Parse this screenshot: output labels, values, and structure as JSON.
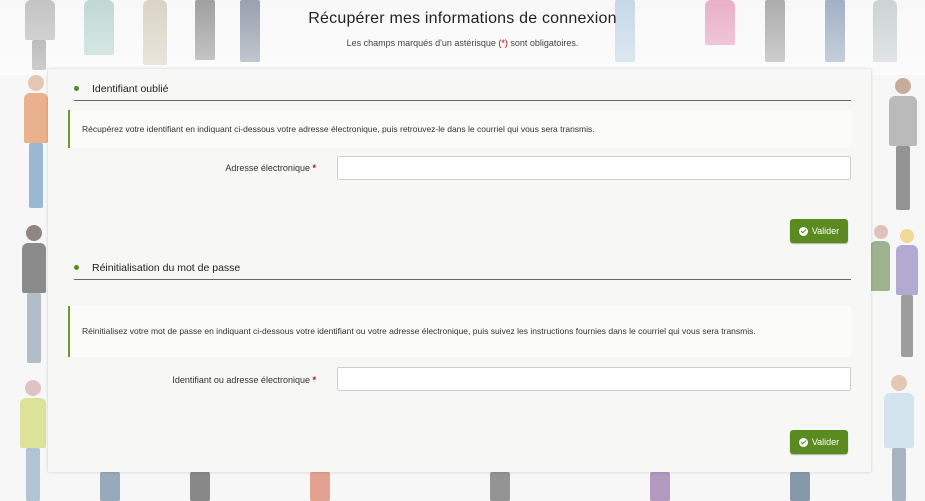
{
  "header": {
    "title": "Récupérer mes informations de connexion",
    "note_before": "Les champs marqués d'un astérisque ",
    "note_star": "(*)",
    "note_after": " sont obligatoires."
  },
  "sections": [
    {
      "title": "Identifiant oublié",
      "info": "Récupérez votre identifiant en indiquant ci-dessous votre adresse électronique, puis retrouvez-le dans le courriel qui vous sera transmis.",
      "field_label": "Adresse électronique",
      "field_value": "",
      "required_mark": "*",
      "button_label": "Valider"
    },
    {
      "title": "Réinitialisation du mot de passe",
      "info": "Réinitialisez votre mot de passe en indiquant ci-dessous votre identifiant ou votre adresse électronique, puis suivez les instructions fournies dans le courriel qui vous sera transmis.",
      "field_label": "Identifiant ou adresse électronique",
      "field_value": "",
      "required_mark": "*",
      "button_label": "Valider"
    }
  ],
  "colors": {
    "accent": "#5b8a21",
    "required": "#cc0000"
  },
  "icons": {
    "button_icon": "check-circle-icon",
    "section_bullet": "bullet-icon"
  }
}
